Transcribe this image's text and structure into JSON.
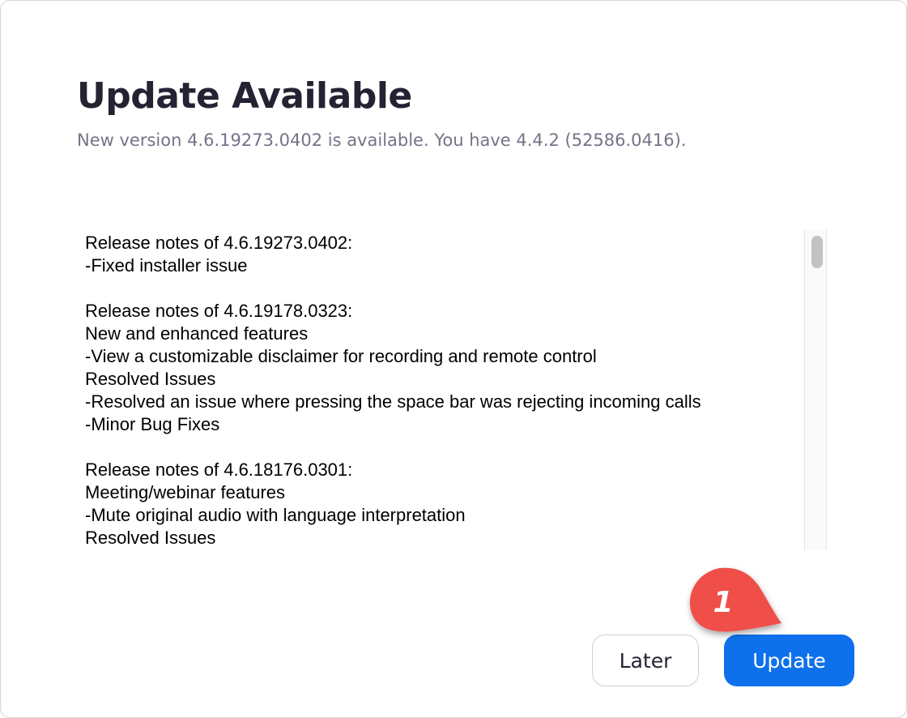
{
  "dialog": {
    "title": "Update Available",
    "subtitle": "New version 4.6.19273.0402 is available. You have 4.4.2 (52586.0416)."
  },
  "release_notes": {
    "lines": [
      "Release notes of 4.6.19273.0402:",
      "-Fixed installer issue",
      "",
      "Release notes of 4.6.19178.0323:",
      "New and enhanced features",
      "-View a customizable disclaimer for recording and remote control",
      "Resolved Issues",
      "-Resolved an issue where pressing the space bar was rejecting incoming calls",
      "-Minor Bug Fixes",
      "",
      "Release notes of 4.6.18176.0301:",
      "Meeting/webinar features",
      "-Mute original audio with language interpretation",
      "Resolved Issues"
    ]
  },
  "buttons": {
    "later_label": "Later",
    "update_label": "Update"
  },
  "annotation": {
    "step_number": "1",
    "color": "#f0504a"
  },
  "colors": {
    "primary": "#0e71eb",
    "title_text": "#232333",
    "subtitle_text": "#747487"
  }
}
